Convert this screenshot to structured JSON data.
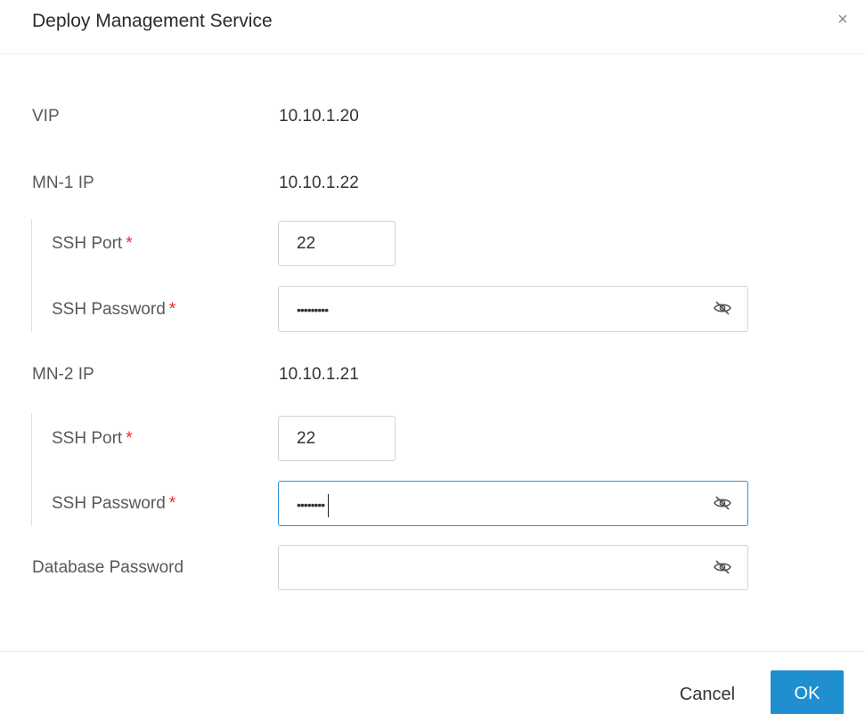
{
  "dialog": {
    "title": "Deploy Management Service",
    "close_icon": "×"
  },
  "vip": {
    "label": "VIP",
    "value": "10.10.1.20"
  },
  "mn1": {
    "label": "MN-1 IP",
    "value": "10.10.1.22",
    "ssh_port_label": "SSH Port",
    "ssh_port_value": "22",
    "ssh_password_label": "SSH Password",
    "ssh_password_masked": "•••••••••"
  },
  "mn2": {
    "label": "MN-2 IP",
    "value": "10.10.1.21",
    "ssh_port_label": "SSH Port",
    "ssh_port_value": "22",
    "ssh_password_label": "SSH Password",
    "ssh_password_masked": "••••••••"
  },
  "database": {
    "password_label": "Database Password",
    "password_value": ""
  },
  "required_mark": "*",
  "footer": {
    "cancel_label": "Cancel",
    "ok_label": "OK"
  },
  "icons": {
    "close": "close-icon",
    "password_toggle": "eye-off-icon"
  },
  "colors": {
    "primary": "#1f8fcf",
    "required": "#f5222d",
    "focus_border": "#2f8fd6"
  }
}
